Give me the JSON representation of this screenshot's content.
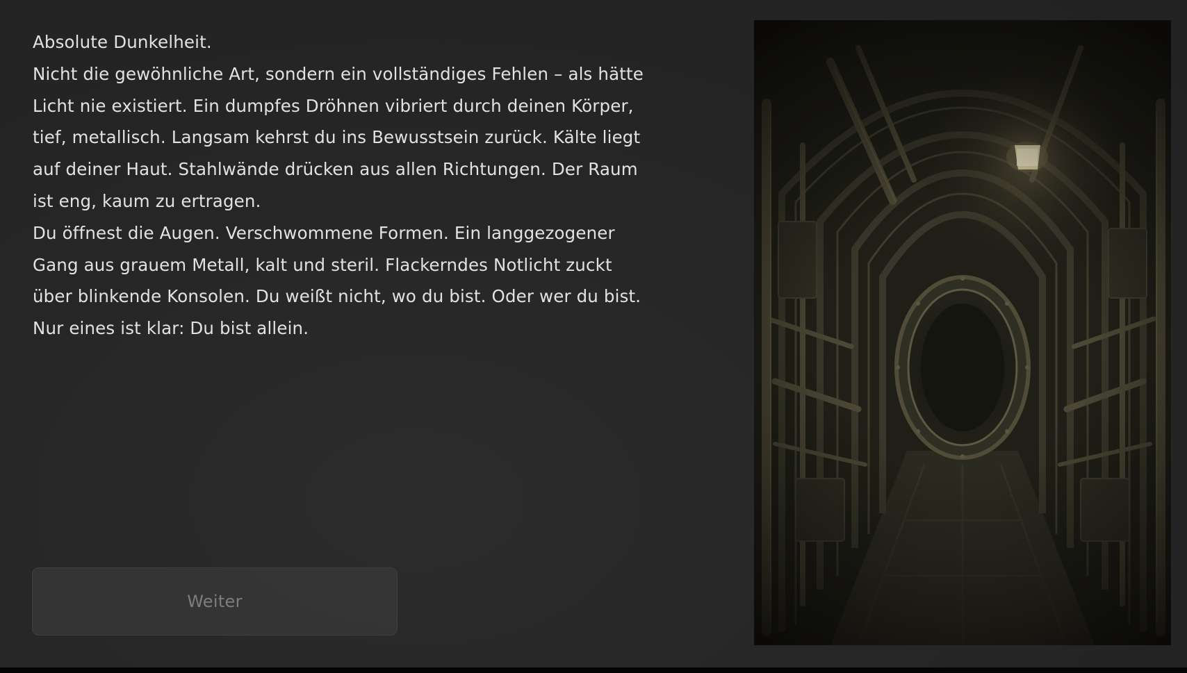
{
  "story": {
    "lines": [
      "Absolute Dunkelheit.",
      "Nicht die gewöhnliche Art, sondern ein vollständiges Fehlen – als hätte",
      "Licht nie existiert. Ein dumpfes Dröhnen vibriert durch deinen Körper,",
      "tief, metallisch. Langsam kehrst du ins Bewusstsein zurück. Kälte liegt",
      "auf deiner Haut. Stahlwände drücken aus allen Richtungen. Der Raum",
      "ist eng, kaum zu ertragen.",
      "Du öffnest die Augen. Verschwommene Formen. Ein langgezogener",
      "Gang aus grauem Metall, kalt und steril. Flackerndes Notlicht zuckt",
      "über blinkende Konsolen. Du weißt nicht, wo du bist. Oder wer du bist.",
      "Nur eines ist klar: Du bist allein."
    ]
  },
  "actions": {
    "continue_label": "Weiter"
  },
  "scene": {
    "illustration": "dark-metal-corridor",
    "colors": {
      "background": "#262626",
      "text": "#e2e2e2",
      "button_text": "#7d7d7d",
      "lamp": "#e8dcb0"
    }
  }
}
